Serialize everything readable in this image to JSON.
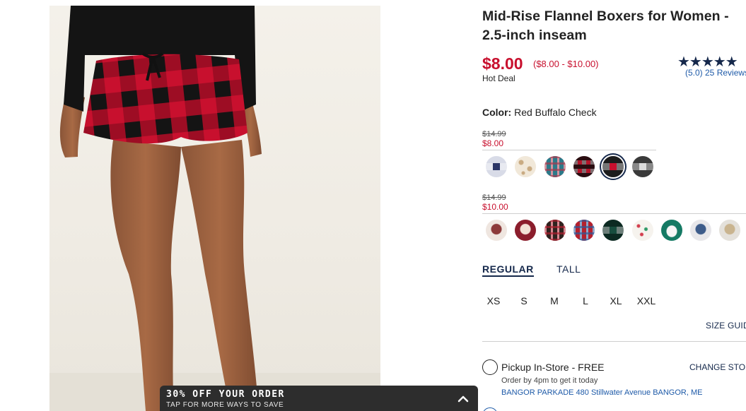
{
  "product": {
    "title": "Mid-Rise Flannel Boxers for Women - 2.5-inch inseam",
    "price": "$8.00",
    "price_range": "($8.00 - $10.00)",
    "deal_label": "Hot Deal",
    "rating": {
      "stars": "★★★★★",
      "value": 5.0,
      "text": "(5.0) 25 Reviews"
    },
    "color_label": "Color:",
    "color_value": "Red Buffalo Check"
  },
  "price_groups": [
    {
      "old_price": "$14.99",
      "new_price": "$8.00",
      "swatches": [
        {
          "name": "navy-plaid",
          "pattern": "navy-check",
          "colors": [
            "#2a3566",
            "#d8dbe7"
          ]
        },
        {
          "name": "cream-leopard",
          "pattern": "leopard",
          "colors": [
            "#f1e8d9",
            "#c9ab82"
          ]
        },
        {
          "name": "teal-plaid",
          "pattern": "tartan",
          "colors": [
            "#2c7a8a",
            "#a63a4e"
          ]
        },
        {
          "name": "red-mini-check",
          "pattern": "mini-check",
          "colors": [
            "#b3142a",
            "#2a0c10"
          ]
        },
        {
          "name": "red-buffalo-check",
          "pattern": "buffalo",
          "colors": [
            "#c8102e",
            "#1c1c1c"
          ],
          "selected": true
        },
        {
          "name": "gray-check",
          "pattern": "gray-check",
          "colors": [
            "#dcdcdc",
            "#3a3a3a"
          ]
        }
      ]
    },
    {
      "old_price": "$14.99",
      "new_price": "$10.00",
      "swatches": [
        {
          "name": "gnome-print",
          "pattern": "gnome",
          "colors": [
            "#efe6e0",
            "#8c3a3a"
          ]
        },
        {
          "name": "santa-print",
          "pattern": "santa",
          "colors": [
            "#8b1d2c",
            "#f2e1d6"
          ]
        },
        {
          "name": "dark-tartan",
          "pattern": "tartan",
          "colors": [
            "#30221f",
            "#b01e2e"
          ]
        },
        {
          "name": "red-tartan",
          "pattern": "tartan",
          "colors": [
            "#b5212e",
            "#2d5a9a"
          ]
        },
        {
          "name": "green-plaid",
          "pattern": "green-check",
          "colors": [
            "#174d3e",
            "#0c2a22"
          ]
        },
        {
          "name": "dot-print",
          "pattern": "dots",
          "colors": [
            "#f6f3ee",
            "#d33f4f"
          ]
        },
        {
          "name": "teal-sheep",
          "pattern": "sheep",
          "colors": [
            "#157a64",
            "#f5f5f5"
          ]
        },
        {
          "name": "bear-print",
          "pattern": "bear",
          "colors": [
            "#e8e7ea",
            "#3e5c8a"
          ]
        },
        {
          "name": "llama-print",
          "pattern": "llama",
          "colors": [
            "#e4e1db",
            "#c9b48f"
          ]
        }
      ]
    }
  ],
  "fit_tabs": [
    {
      "label": "REGULAR",
      "active": true
    },
    {
      "label": "TALL",
      "active": false
    }
  ],
  "sizes": [
    "XS",
    "S",
    "M",
    "L",
    "XL",
    "XXL"
  ],
  "size_guide_label": "SIZE GUIDE",
  "pickup": {
    "label": "Pickup In-Store - FREE",
    "change_store": "CHANGE STORE",
    "note": "Order by 4pm to get it today",
    "store_address": "BANGOR PARKADE 480 Stillwater Avenue  BANGOR, ME"
  },
  "promo": {
    "title": "30% OFF YOUR ORDER",
    "subtitle": "TAP FOR MORE WAYS TO SAVE"
  },
  "colors": {
    "sale_red": "#c8102e",
    "navy": "#15284b",
    "link_blue": "#1e5aa8",
    "banner_bg": "#2d2d2d"
  }
}
